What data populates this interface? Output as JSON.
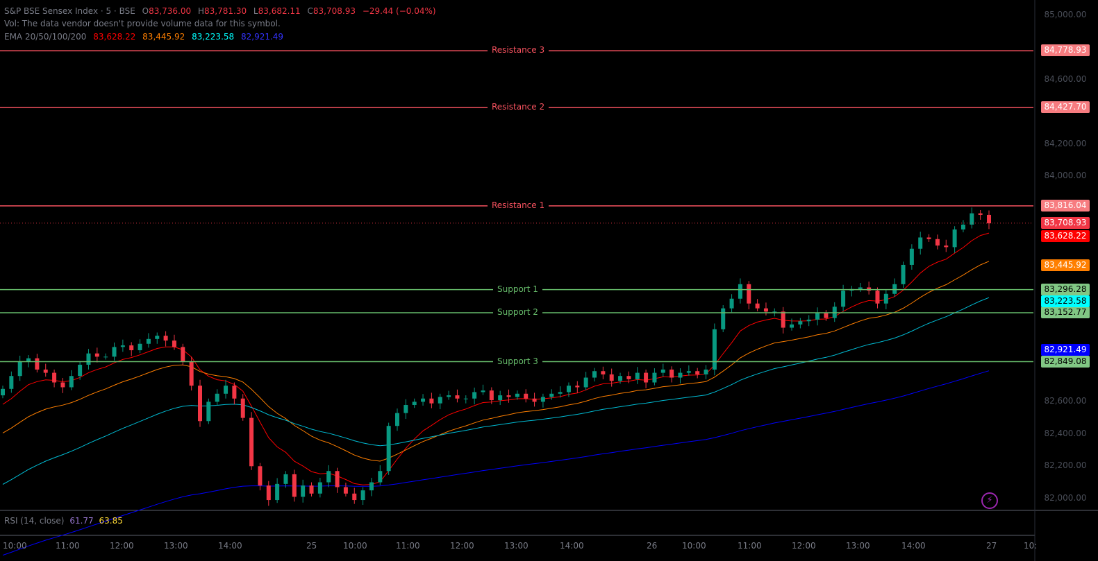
{
  "legend": {
    "symbol": "S&P BSE Sensex Index · 5 · BSE",
    "open_label": "O",
    "open": "83,736.00",
    "high_label": "H",
    "high": "83,781.30",
    "low_label": "L",
    "low": "83,682.11",
    "close_label": "C",
    "close": "83,708.93",
    "change": "−29.44 (−0.04%)",
    "vol_text": "Vol: The data vendor doesn't provide volume data for this symbol.",
    "ema_label": "EMA 20/50/100/200",
    "ema20": "83,628.22",
    "ema50": "83,445.92",
    "ema100": "83,223.58",
    "ema200": "82,921.49"
  },
  "rsi": {
    "label": "RSI (14, close)",
    "v1": "61.77",
    "v2": "63.85"
  },
  "levels": [
    {
      "name": "Resistance 3",
      "price": 84778.93,
      "text": "84,778.93",
      "kind": "res"
    },
    {
      "name": "Resistance 2",
      "price": 84427.7,
      "text": "84,427.70",
      "kind": "res"
    },
    {
      "name": "Resistance 1",
      "price": 83816.04,
      "text": "83,816.04",
      "kind": "res"
    },
    {
      "name": "Support 1",
      "price": 83296.28,
      "text": "83,296.28",
      "kind": "sup"
    },
    {
      "name": "Support 2",
      "price": 83152.77,
      "text": "83,152.77",
      "kind": "sup"
    },
    {
      "name": "Support 3",
      "price": 82849.08,
      "text": "82,849.08",
      "kind": "sup"
    }
  ],
  "price_badges": [
    {
      "text": "83,708.93",
      "price": 83708.93,
      "color": "#f23645",
      "fg": "#ffffff"
    },
    {
      "text": "83,628.22",
      "price": 83628.22,
      "color": "#ff0000",
      "fg": "#ffffff"
    },
    {
      "text": "83,445.92",
      "price": 83445.92,
      "color": "#ff7f00",
      "fg": "#ffffff"
    },
    {
      "text": "83,223.58",
      "price": 83223.58,
      "color": "#00ffff",
      "fg": "#000000"
    },
    {
      "text": "82,921.49",
      "price": 82921.49,
      "color": "#0000ff",
      "fg": "#ffffff"
    }
  ],
  "price_ticks": [
    "85,000.00",
    "84,600.00",
    "84,200.00",
    "84,000.00",
    "82,600.00",
    "82,400.00",
    "82,200.00",
    "82,000.00"
  ],
  "time_ticks": [
    "10:00",
    "11:00",
    "12:00",
    "13:00",
    "14:00",
    "25",
    "10:00",
    "11:00",
    "12:00",
    "13:00",
    "14:00",
    "26",
    "10:00",
    "11:00",
    "12:00",
    "13:00",
    "14:00",
    "27",
    "10:"
  ],
  "colors": {
    "resistance": "#f7525f",
    "support": "#66bb6a",
    "up": "#089981",
    "down": "#f23645",
    "ema20": "#ff0000",
    "ema50": "#ff7f00",
    "ema100": "#00bcd4",
    "ema200": "#0000ff"
  },
  "chart_data": {
    "type": "candlestick",
    "yrange": [
      81930,
      85060
    ],
    "close_series": [
      82680,
      82760,
      82850,
      82870,
      82800,
      82780,
      82720,
      82690,
      82760,
      82830,
      82900,
      82880,
      82880,
      82940,
      82950,
      82920,
      82960,
      82990,
      83010,
      82980,
      82940,
      82850,
      82700,
      82480,
      82600,
      82650,
      82700,
      82620,
      82500,
      82200,
      82080,
      81990,
      82090,
      82150,
      82010,
      82080,
      82030,
      82100,
      82170,
      82070,
      82030,
      81990,
      82050,
      82100,
      82170,
      82450,
      82530,
      82580,
      82600,
      82620,
      82590,
      82630,
      82640,
      82620,
      82620,
      82660,
      82670,
      82610,
      82640,
      82630,
      82650,
      82620,
      82600,
      82630,
      82650,
      82660,
      82700,
      82690,
      82750,
      82790,
      82770,
      82730,
      82760,
      82740,
      82780,
      82720,
      82780,
      82800,
      82750,
      82780,
      82790,
      82770,
      82800,
      83050,
      83180,
      83240,
      83330,
      83210,
      83180,
      83160,
      83160,
      83060,
      83080,
      83100,
      83110,
      83150,
      83120,
      83190,
      83290,
      83300,
      83310,
      83290,
      83210,
      83270,
      83330,
      83450,
      83550,
      83620,
      83610,
      83570,
      83560,
      83670,
      83700,
      83770,
      83760,
      83708
    ]
  },
  "icon": "lightning-icon"
}
